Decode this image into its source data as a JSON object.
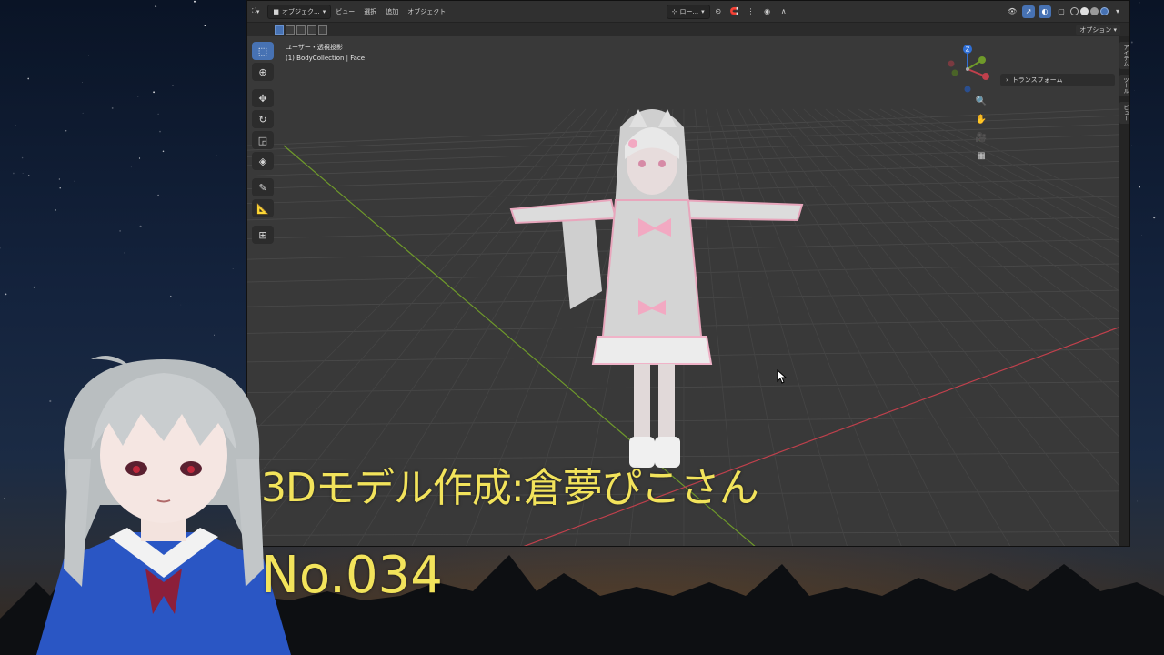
{
  "header": {
    "editor_type_icon": "viewport-icon",
    "mode_label": "オブジェク...",
    "menus": [
      "ビュー",
      "選択",
      "追加",
      "オブジェクト"
    ],
    "transform_orientation": "ロー...",
    "options_label": "オプション"
  },
  "viewport": {
    "view_name": "ユーザー・透視投影",
    "object_info": "(1) BodyCollection | Face"
  },
  "toolbar": {
    "tools": [
      "select-box",
      "cursor",
      "move",
      "rotate",
      "scale",
      "transform",
      "annotate",
      "measure",
      "add-cube"
    ]
  },
  "gizmo": {
    "x_label": "",
    "y_label": "",
    "z_label": "Z"
  },
  "npanel": {
    "section_label": "トランスフォーム",
    "tabs": [
      "アイテム",
      "ツール",
      "ビュー"
    ]
  },
  "overlay": {
    "title": "3Dモデル作成:倉夢ぴこさん",
    "number": "No.034"
  },
  "colors": {
    "caption": "#f2e35b",
    "blender_accent": "#4772b3",
    "axis_x": "#c0404c",
    "axis_y": "#6f9a2a"
  }
}
